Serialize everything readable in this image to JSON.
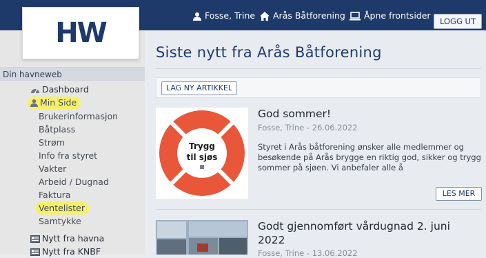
{
  "header": {
    "logo_text": "HW",
    "user": "Fosse, Trine",
    "org": "Arås Båtforening",
    "open_pages": "Åpne frontsider",
    "logout": "LOGG UT"
  },
  "sidebar": {
    "heading": "Din havneweb",
    "items": [
      {
        "label": "Dashboard",
        "icon": "dashboard-icon"
      },
      {
        "label": "Min Side",
        "icon": "user-icon"
      },
      {
        "label": "Brukerinformasjon"
      },
      {
        "label": "Båtplass"
      },
      {
        "label": "Strøm"
      },
      {
        "label": "Info fra styret"
      },
      {
        "label": "Vakter"
      },
      {
        "label": "Arbeid / Dugnad"
      },
      {
        "label": "Faktura"
      },
      {
        "label": "Ventelister"
      },
      {
        "label": "Samtykke"
      },
      {
        "label": "Nytt fra havna",
        "icon": "news-icon"
      },
      {
        "label": "Nytt fra KNBF",
        "icon": "news-icon"
      }
    ]
  },
  "main": {
    "title": "Siste nytt fra Arås Båtforening",
    "new_article": "LAG NY ARTIKKEL",
    "articles": [
      {
        "title": "God sommer!",
        "meta": "Fosse, Trine - 26.06.2022",
        "excerpt": "Styret i Arås båtforening ønsker alle medlemmer og besøkende på Arås brygge en riktig god, sikker og trygg sommer på sjøen. Vi anbefaler alle å",
        "read_more": "LES MER",
        "image_text_1": "Trygg",
        "image_text_2": "til sjøs"
      },
      {
        "title_1": "Godt gjennomført vårdugnad 2. juni",
        "title_2": "2022",
        "meta": "Fosse, Trine - 13.06.2022"
      }
    ]
  },
  "colors": {
    "topbar": "#1e3a6b",
    "accent": "#1e3a6b",
    "highlight": "#f5f06a",
    "lifebuoy": "#e8573a"
  }
}
